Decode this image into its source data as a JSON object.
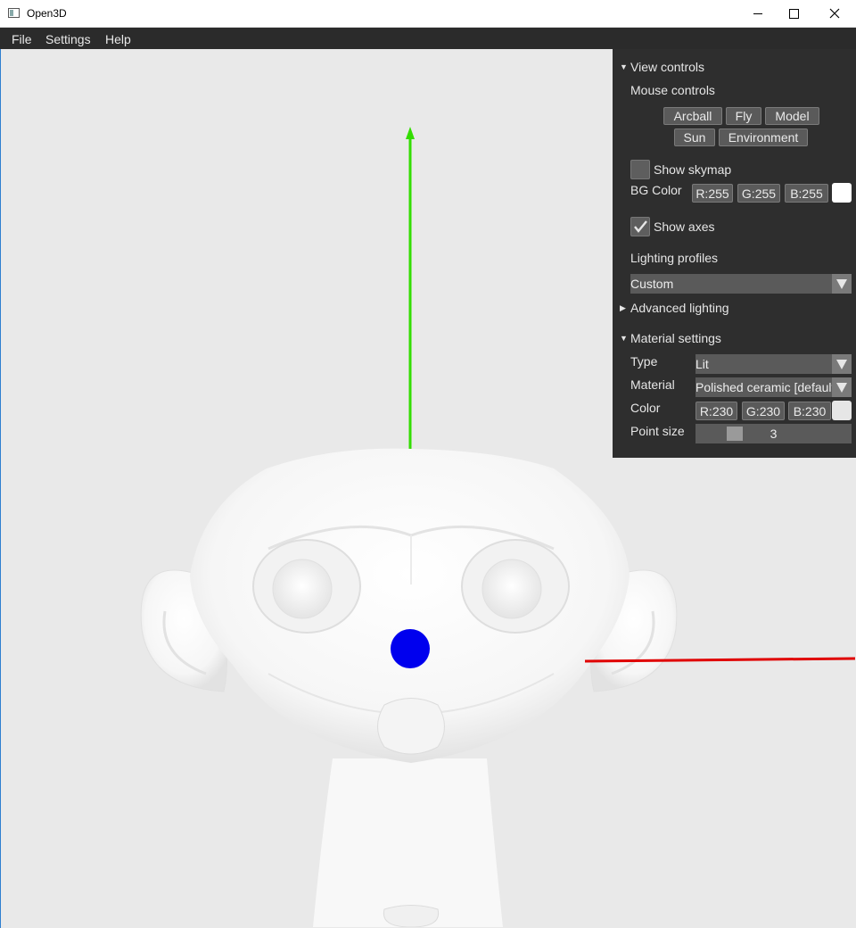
{
  "window": {
    "title": "Open3D"
  },
  "menu": {
    "items": [
      "File",
      "Settings",
      "Help"
    ]
  },
  "panel": {
    "view_controls": {
      "header": "View controls",
      "mouse_controls_label": "Mouse controls",
      "mouse_buttons": [
        "Arcball",
        "Fly",
        "Model",
        "Sun",
        "Environment"
      ],
      "show_skymap_label": "Show skymap",
      "show_skymap_checked": false,
      "bg_color_label": "BG Color",
      "bg_color": {
        "r": "R:255",
        "g": "G:255",
        "b": "B:255",
        "swatch": "#ffffff"
      },
      "show_axes_label": "Show axes",
      "show_axes_checked": true,
      "lighting_profiles_label": "Lighting profiles",
      "lighting_profile_value": "Custom",
      "advanced_lighting_label": "Advanced lighting"
    },
    "material_settings": {
      "header": "Material settings",
      "type_label": "Type",
      "type_value": "Lit",
      "material_label": "Material",
      "material_value": "Polished ceramic [default]",
      "color_label": "Color",
      "color": {
        "r": "R:230",
        "g": "G:230",
        "b": "B:230",
        "swatch": "#e6e6e6"
      },
      "point_size_label": "Point size",
      "point_size_value": "3"
    }
  },
  "scene": {
    "background": "#e9e9e9",
    "axis_colors": {
      "x": "#e00000",
      "y": "#33dd00",
      "z": "#0000ee"
    },
    "model": "monkey-head-mesh"
  }
}
